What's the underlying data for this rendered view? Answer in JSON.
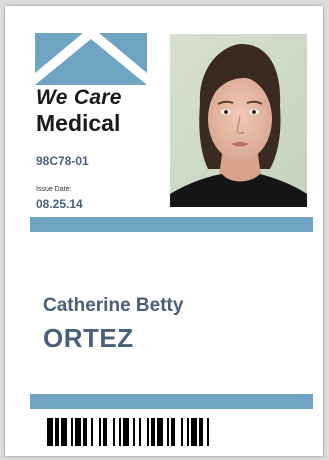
{
  "brand": {
    "line1": "We Care",
    "line2": "Medical",
    "accent_color": "#6fa4c2",
    "text_color": "#4a5f78"
  },
  "badge": {
    "id_number": "98C78-01",
    "issue_label": "Issue Date:",
    "issue_date": "08.25.14"
  },
  "person": {
    "first_name": "Catherine Betty",
    "last_name": "ORTEZ"
  },
  "photo": {
    "icon": "portrait-photo"
  },
  "barcode": {
    "icon": "barcode"
  }
}
